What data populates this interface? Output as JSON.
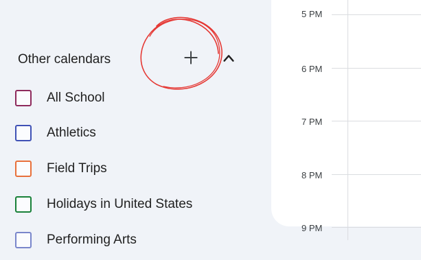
{
  "sidebar": {
    "section_title": "Other calendars",
    "add_icon": "plus-icon",
    "collapse_icon": "chevron-up-icon",
    "annotation_color": "#e53935",
    "calendars": [
      {
        "label": "All School",
        "color": "#8e2a5c"
      },
      {
        "label": "Athletics",
        "color": "#3f51b5"
      },
      {
        "label": "Field Trips",
        "color": "#e8703a"
      },
      {
        "label": "Holidays in United States",
        "color": "#188038"
      },
      {
        "label": "Performing Arts",
        "color": "#7986cb"
      }
    ]
  },
  "day_view": {
    "hours": [
      "5 PM",
      "6 PM",
      "7 PM",
      "8 PM",
      "9 PM"
    ]
  }
}
